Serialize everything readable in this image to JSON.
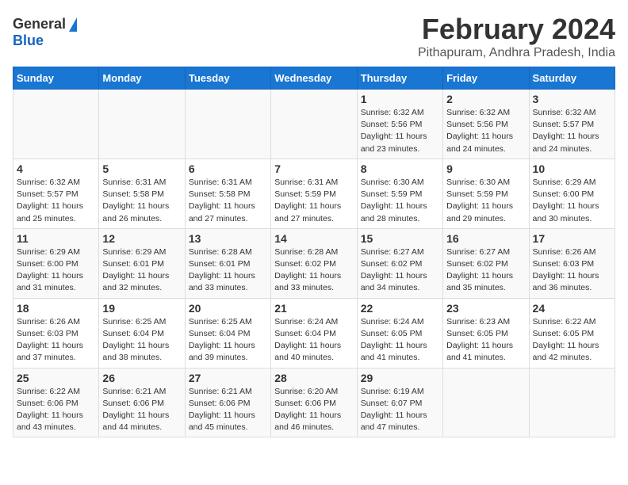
{
  "header": {
    "logo_general": "General",
    "logo_blue": "Blue",
    "title": "February 2024",
    "subtitle": "Pithapuram, Andhra Pradesh, India"
  },
  "days_of_week": [
    "Sunday",
    "Monday",
    "Tuesday",
    "Wednesday",
    "Thursday",
    "Friday",
    "Saturday"
  ],
  "weeks": [
    [
      {
        "num": "",
        "sunrise": "",
        "sunset": "",
        "daylight": ""
      },
      {
        "num": "",
        "sunrise": "",
        "sunset": "",
        "daylight": ""
      },
      {
        "num": "",
        "sunrise": "",
        "sunset": "",
        "daylight": ""
      },
      {
        "num": "",
        "sunrise": "",
        "sunset": "",
        "daylight": ""
      },
      {
        "num": "1",
        "sunrise": "6:32 AM",
        "sunset": "5:56 PM",
        "daylight": "11 hours and 23 minutes."
      },
      {
        "num": "2",
        "sunrise": "6:32 AM",
        "sunset": "5:56 PM",
        "daylight": "11 hours and 24 minutes."
      },
      {
        "num": "3",
        "sunrise": "6:32 AM",
        "sunset": "5:57 PM",
        "daylight": "11 hours and 24 minutes."
      }
    ],
    [
      {
        "num": "4",
        "sunrise": "6:32 AM",
        "sunset": "5:57 PM",
        "daylight": "11 hours and 25 minutes."
      },
      {
        "num": "5",
        "sunrise": "6:31 AM",
        "sunset": "5:58 PM",
        "daylight": "11 hours and 26 minutes."
      },
      {
        "num": "6",
        "sunrise": "6:31 AM",
        "sunset": "5:58 PM",
        "daylight": "11 hours and 27 minutes."
      },
      {
        "num": "7",
        "sunrise": "6:31 AM",
        "sunset": "5:59 PM",
        "daylight": "11 hours and 27 minutes."
      },
      {
        "num": "8",
        "sunrise": "6:30 AM",
        "sunset": "5:59 PM",
        "daylight": "11 hours and 28 minutes."
      },
      {
        "num": "9",
        "sunrise": "6:30 AM",
        "sunset": "5:59 PM",
        "daylight": "11 hours and 29 minutes."
      },
      {
        "num": "10",
        "sunrise": "6:29 AM",
        "sunset": "6:00 PM",
        "daylight": "11 hours and 30 minutes."
      }
    ],
    [
      {
        "num": "11",
        "sunrise": "6:29 AM",
        "sunset": "6:00 PM",
        "daylight": "11 hours and 31 minutes."
      },
      {
        "num": "12",
        "sunrise": "6:29 AM",
        "sunset": "6:01 PM",
        "daylight": "11 hours and 32 minutes."
      },
      {
        "num": "13",
        "sunrise": "6:28 AM",
        "sunset": "6:01 PM",
        "daylight": "11 hours and 33 minutes."
      },
      {
        "num": "14",
        "sunrise": "6:28 AM",
        "sunset": "6:02 PM",
        "daylight": "11 hours and 33 minutes."
      },
      {
        "num": "15",
        "sunrise": "6:27 AM",
        "sunset": "6:02 PM",
        "daylight": "11 hours and 34 minutes."
      },
      {
        "num": "16",
        "sunrise": "6:27 AM",
        "sunset": "6:02 PM",
        "daylight": "11 hours and 35 minutes."
      },
      {
        "num": "17",
        "sunrise": "6:26 AM",
        "sunset": "6:03 PM",
        "daylight": "11 hours and 36 minutes."
      }
    ],
    [
      {
        "num": "18",
        "sunrise": "6:26 AM",
        "sunset": "6:03 PM",
        "daylight": "11 hours and 37 minutes."
      },
      {
        "num": "19",
        "sunrise": "6:25 AM",
        "sunset": "6:04 PM",
        "daylight": "11 hours and 38 minutes."
      },
      {
        "num": "20",
        "sunrise": "6:25 AM",
        "sunset": "6:04 PM",
        "daylight": "11 hours and 39 minutes."
      },
      {
        "num": "21",
        "sunrise": "6:24 AM",
        "sunset": "6:04 PM",
        "daylight": "11 hours and 40 minutes."
      },
      {
        "num": "22",
        "sunrise": "6:24 AM",
        "sunset": "6:05 PM",
        "daylight": "11 hours and 41 minutes."
      },
      {
        "num": "23",
        "sunrise": "6:23 AM",
        "sunset": "6:05 PM",
        "daylight": "11 hours and 41 minutes."
      },
      {
        "num": "24",
        "sunrise": "6:22 AM",
        "sunset": "6:05 PM",
        "daylight": "11 hours and 42 minutes."
      }
    ],
    [
      {
        "num": "25",
        "sunrise": "6:22 AM",
        "sunset": "6:06 PM",
        "daylight": "11 hours and 43 minutes."
      },
      {
        "num": "26",
        "sunrise": "6:21 AM",
        "sunset": "6:06 PM",
        "daylight": "11 hours and 44 minutes."
      },
      {
        "num": "27",
        "sunrise": "6:21 AM",
        "sunset": "6:06 PM",
        "daylight": "11 hours and 45 minutes."
      },
      {
        "num": "28",
        "sunrise": "6:20 AM",
        "sunset": "6:06 PM",
        "daylight": "11 hours and 46 minutes."
      },
      {
        "num": "29",
        "sunrise": "6:19 AM",
        "sunset": "6:07 PM",
        "daylight": "11 hours and 47 minutes."
      },
      {
        "num": "",
        "sunrise": "",
        "sunset": "",
        "daylight": ""
      },
      {
        "num": "",
        "sunrise": "",
        "sunset": "",
        "daylight": ""
      }
    ]
  ]
}
